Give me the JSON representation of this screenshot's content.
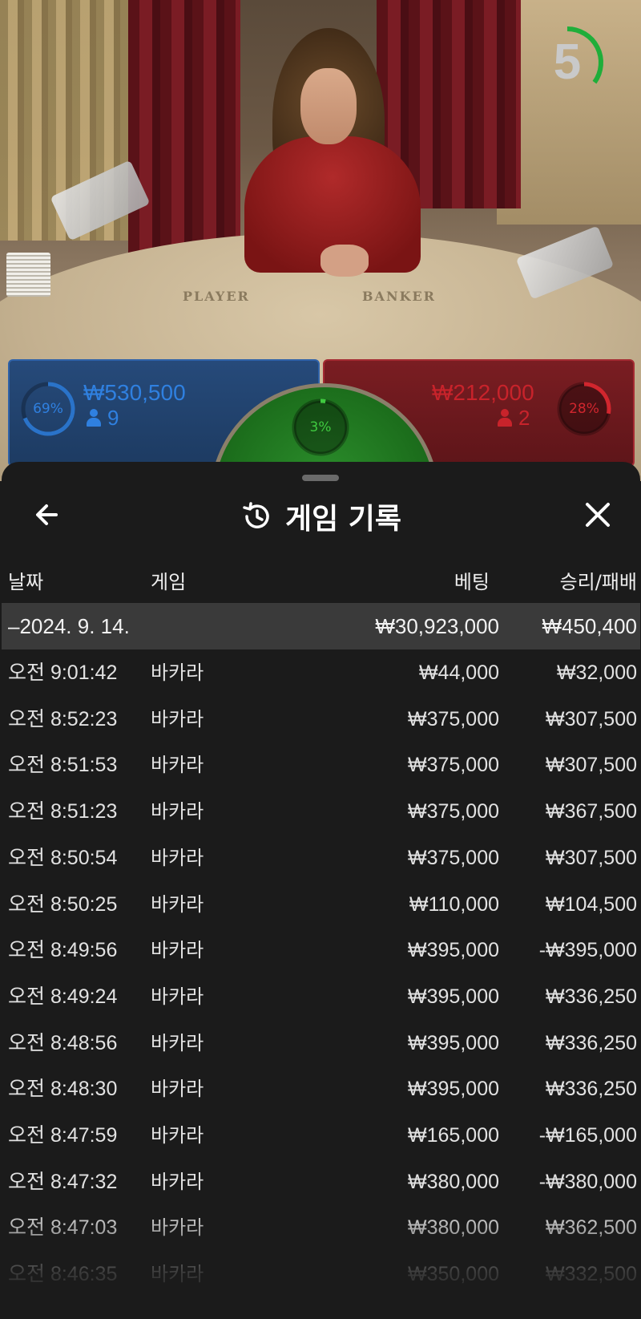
{
  "timer": {
    "value": "5",
    "fraction_remaining": 0.35,
    "color": "#1fae3a"
  },
  "player_panel": {
    "percent": "69%",
    "percent_value": 0.69,
    "amount": "₩530,500",
    "players": "9",
    "color": "#2a73c9"
  },
  "banker_panel": {
    "percent": "28%",
    "percent_value": 0.28,
    "amount": "₩212,000",
    "players": "2",
    "color": "#d1262e"
  },
  "tie_panel": {
    "percent": "3%",
    "percent_value": 0.03,
    "color": "#3fc93f"
  },
  "table_labels": {
    "player": "PLAYER",
    "banker": "BANKER"
  },
  "sheet": {
    "title": "게임 기록",
    "title_icon": "history-icon",
    "back_icon": "arrow-left-icon",
    "close_icon": "close-icon"
  },
  "columns": {
    "date": "날짜",
    "game": "게임",
    "bet": "베팅",
    "win_loss": "승리/패배"
  },
  "summary": {
    "date": "–2024. 9. 14.",
    "bet": "₩30,923,000",
    "win_loss": "₩450,400"
  },
  "rows": [
    {
      "time": "오전 9:01:42",
      "game": "바카라",
      "bet": "₩44,000",
      "win_loss": "₩32,000"
    },
    {
      "time": "오전 8:52:23",
      "game": "바카라",
      "bet": "₩375,000",
      "win_loss": "₩307,500"
    },
    {
      "time": "오전 8:51:53",
      "game": "바카라",
      "bet": "₩375,000",
      "win_loss": "₩307,500"
    },
    {
      "time": "오전 8:51:23",
      "game": "바카라",
      "bet": "₩375,000",
      "win_loss": "₩367,500"
    },
    {
      "time": "오전 8:50:54",
      "game": "바카라",
      "bet": "₩375,000",
      "win_loss": "₩307,500"
    },
    {
      "time": "오전 8:50:25",
      "game": "바카라",
      "bet": "₩110,000",
      "win_loss": "₩104,500"
    },
    {
      "time": "오전 8:49:56",
      "game": "바카라",
      "bet": "₩395,000",
      "win_loss": "-₩395,000"
    },
    {
      "time": "오전 8:49:24",
      "game": "바카라",
      "bet": "₩395,000",
      "win_loss": "₩336,250"
    },
    {
      "time": "오전 8:48:56",
      "game": "바카라",
      "bet": "₩395,000",
      "win_loss": "₩336,250"
    },
    {
      "time": "오전 8:48:30",
      "game": "바카라",
      "bet": "₩395,000",
      "win_loss": "₩336,250"
    },
    {
      "time": "오전 8:47:59",
      "game": "바카라",
      "bet": "₩165,000",
      "win_loss": "-₩165,000"
    },
    {
      "time": "오전 8:47:32",
      "game": "바카라",
      "bet": "₩380,000",
      "win_loss": "-₩380,000"
    },
    {
      "time": "오전 8:47:03",
      "game": "바카라",
      "bet": "₩380,000",
      "win_loss": "₩362,500"
    },
    {
      "time": "오전 8:46:35",
      "game": "바카라",
      "bet": "₩350,000",
      "win_loss": "₩332,500"
    }
  ]
}
